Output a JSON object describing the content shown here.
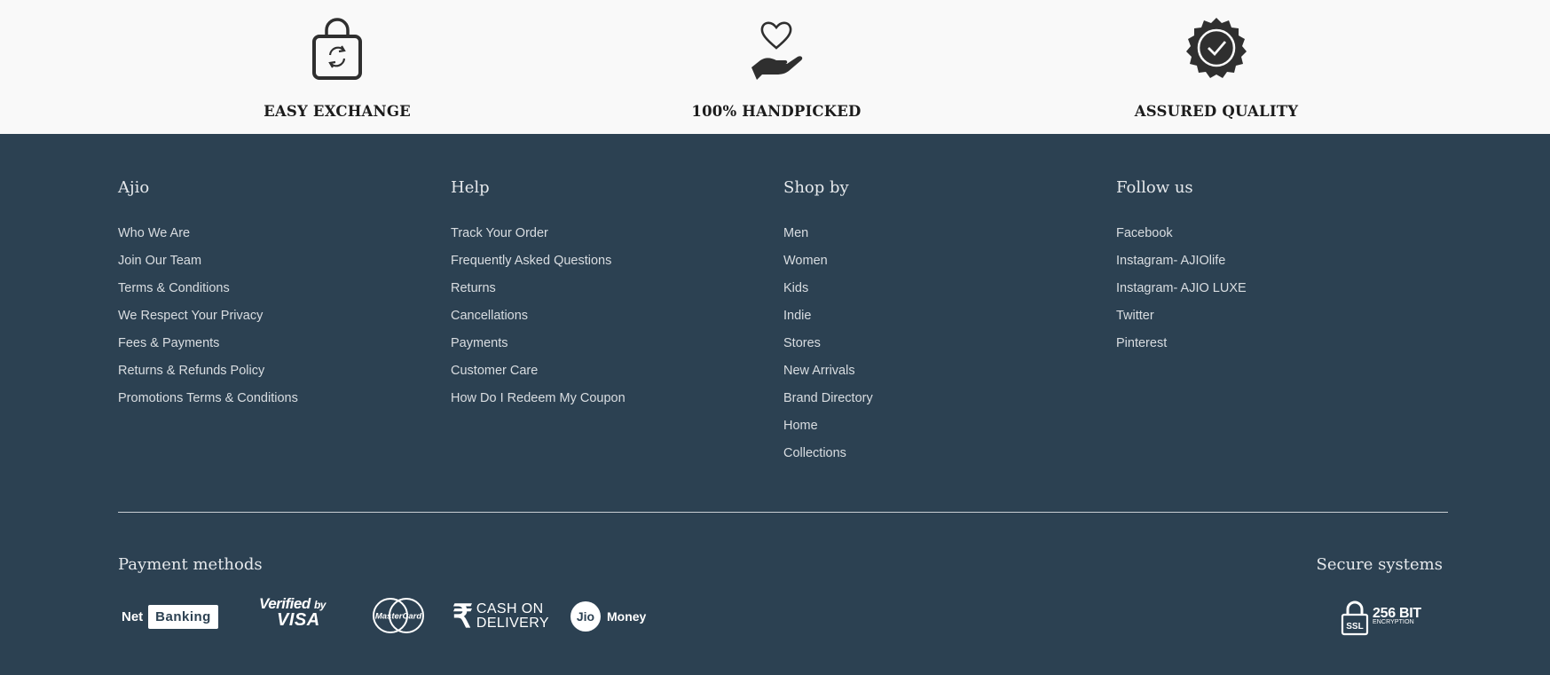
{
  "perks": [
    {
      "icon": "exchange-bag-icon",
      "label": "EASY EXCHANGE"
    },
    {
      "icon": "hand-heart-icon",
      "label": "100% HANDPICKED"
    },
    {
      "icon": "quality-badge-icon",
      "label": "ASSURED QUALITY"
    }
  ],
  "footer": {
    "columns": [
      {
        "title": "Ajio",
        "links": [
          "Who We Are",
          "Join Our Team",
          "Terms & Conditions",
          "We Respect Your Privacy",
          "Fees & Payments",
          "Returns & Refunds Policy",
          "Promotions Terms & Conditions"
        ]
      },
      {
        "title": "Help",
        "links": [
          "Track Your Order",
          "Frequently Asked Questions",
          "Returns",
          "Cancellations",
          "Payments",
          "Customer Care",
          "How Do I Redeem My Coupon"
        ]
      },
      {
        "title": "Shop by",
        "links": [
          "Men",
          "Women",
          "Kids",
          "Indie",
          "Stores",
          "New Arrivals",
          "Brand Directory",
          "Home",
          "Collections"
        ]
      },
      {
        "title": "Follow us",
        "links": [
          "Facebook",
          "Instagram- AJIOlife",
          "Instagram- AJIO LUXE",
          "Twitter",
          "Pinterest"
        ]
      }
    ],
    "payment_title": "Payment methods",
    "secure_title": "Secure systems",
    "payment": {
      "netbanking": {
        "word1": "Net",
        "word2": "Banking"
      },
      "visa": {
        "line1": "Verified",
        "by": "by",
        "line2": "VISA"
      },
      "mastercard": "MasterCard",
      "cod": {
        "symbol": "₹",
        "line1": "CASH ON",
        "line2": "DELIVERY"
      },
      "jio": {
        "circle": "Jio",
        "word": "Money"
      }
    },
    "secure": {
      "lock": "SSL",
      "line1": "256 BIT",
      "line2": "ENCRYPTION"
    }
  },
  "colors": {
    "footer_bg": "#2c4152",
    "perks_bg": "#f9f9f9"
  }
}
